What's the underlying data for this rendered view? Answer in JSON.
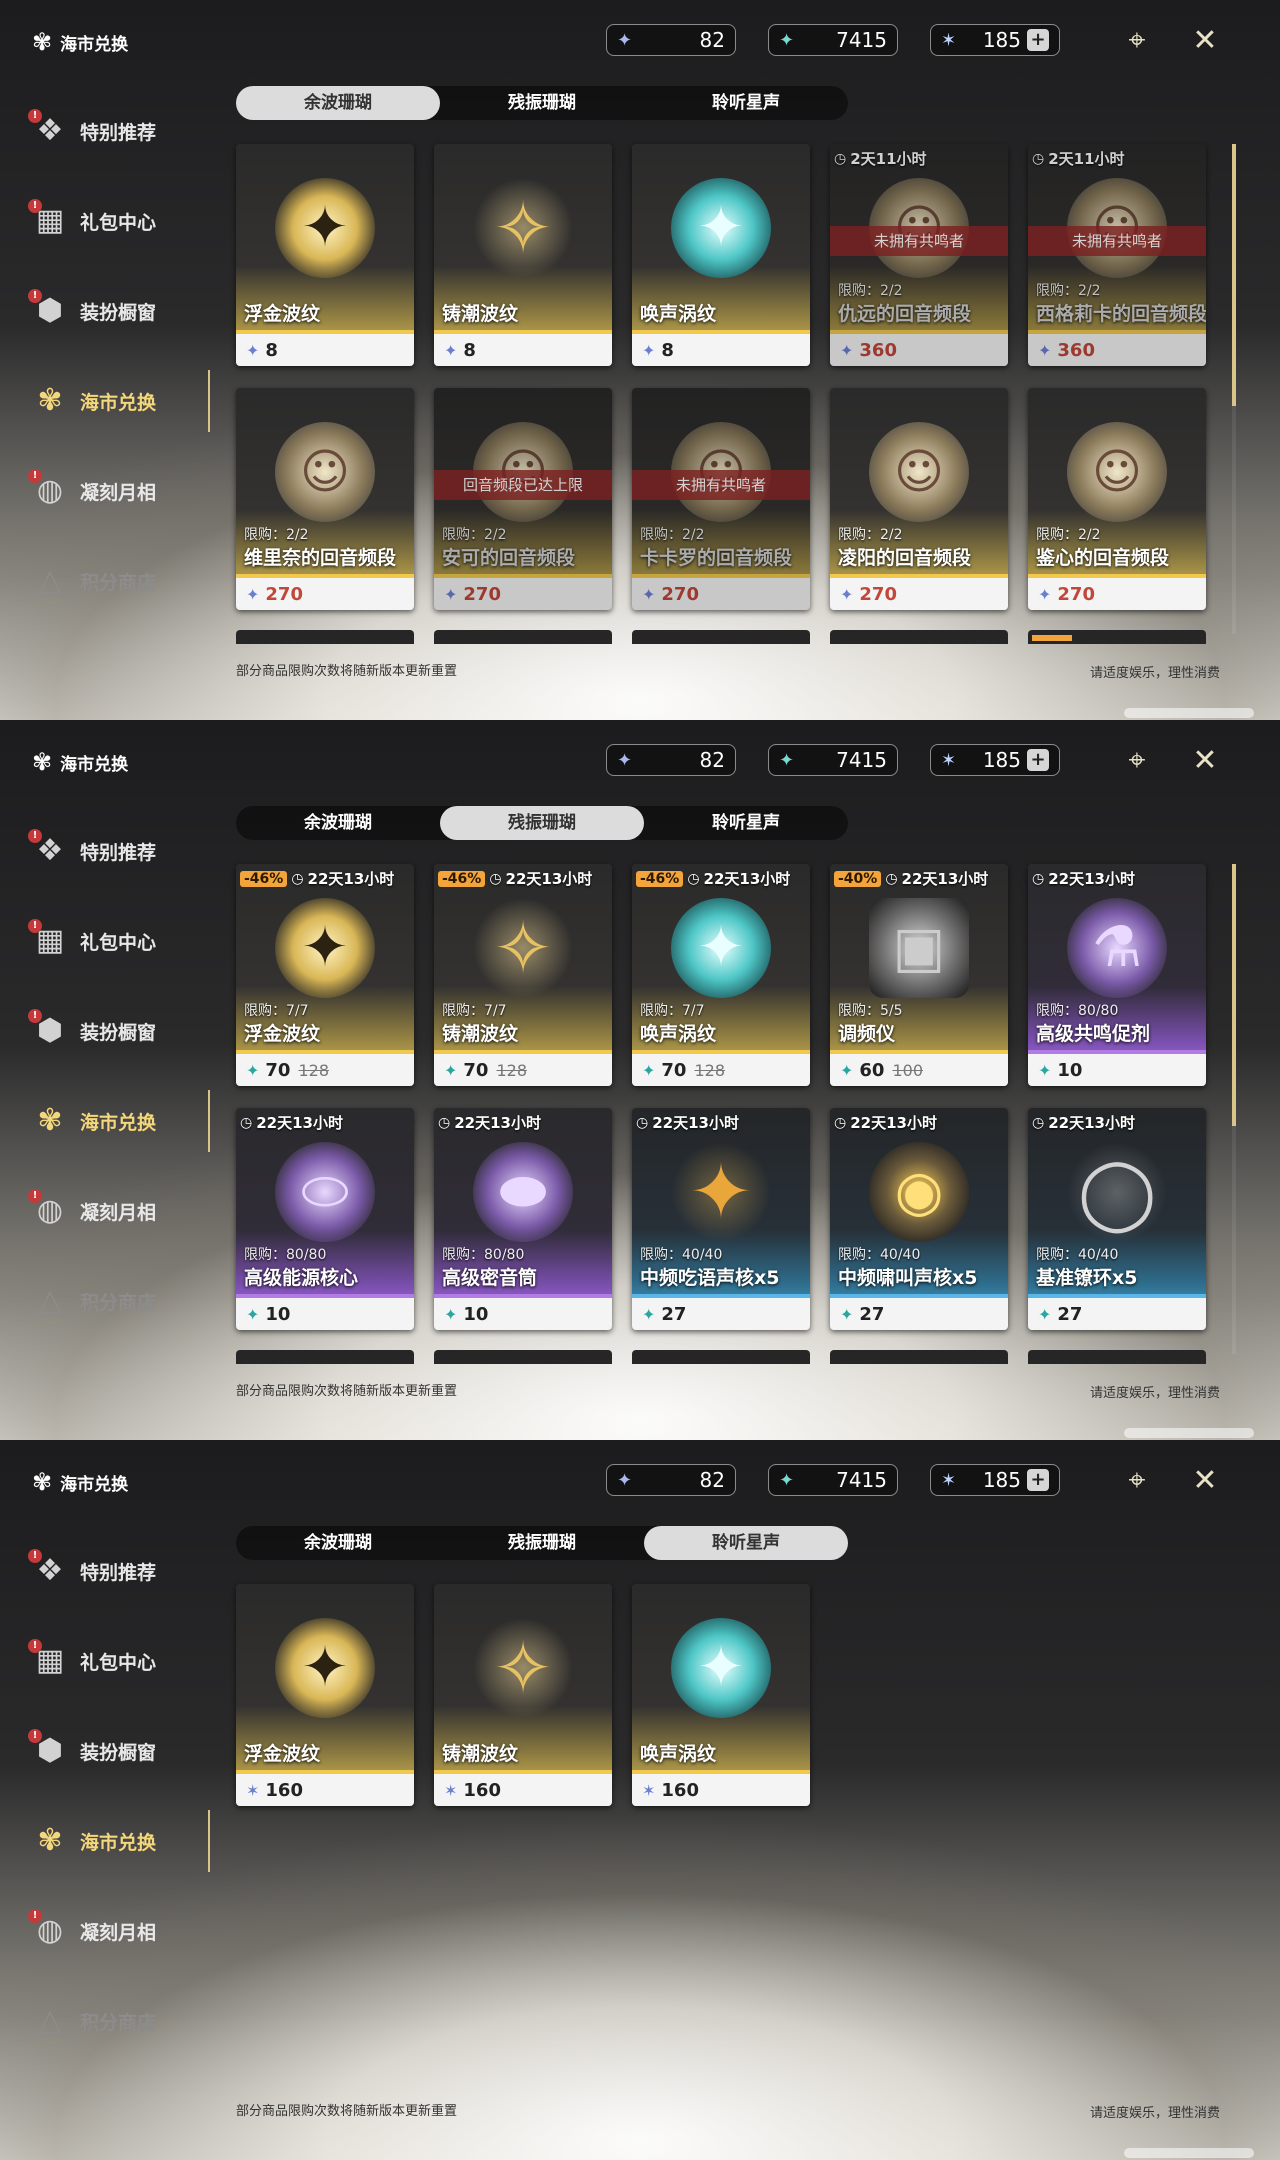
{
  "header": {
    "title": "海市兑换",
    "currencies": [
      {
        "icon": "wave-coral-icon",
        "value": "82"
      },
      {
        "icon": "resonance-coral-icon",
        "value": "7415"
      },
      {
        "icon": "starsong-icon",
        "value": "185",
        "plus": "+"
      }
    ]
  },
  "sidebar": {
    "items": [
      {
        "label": "特别推荐",
        "icon": "featured-icon",
        "badge": "!"
      },
      {
        "label": "礼包中心",
        "icon": "gift-icon",
        "badge": "!"
      },
      {
        "label": "装扮橱窗",
        "icon": "wardrobe-icon",
        "badge": "!"
      },
      {
        "label": "海市兑换",
        "icon": "coral-exchange-icon"
      },
      {
        "label": "凝刻月相",
        "icon": "moon-phase-icon",
        "badge": "!"
      },
      {
        "label": "积分商店",
        "icon": "points-shop-icon"
      }
    ]
  },
  "tabs": [
    "余波珊瑚",
    "残振珊瑚",
    "聆听星声"
  ],
  "footer": {
    "left": "部分商品限购次数将随新版本更新重置",
    "right": "请适度娱乐，理性消费"
  },
  "panels": [
    {
      "active_tab": 0,
      "cards": [
        {
          "name": "浮金波纹",
          "price": "8",
          "art": "gold-wave"
        },
        {
          "name": "铸潮波纹",
          "price": "8",
          "art": "tide-blade"
        },
        {
          "name": "唤声涡纹",
          "price": "8",
          "art": "cyan-vortex"
        },
        {
          "name": "仇远的回音频段",
          "price": "360",
          "timer": "2天11小时",
          "banner": "未拥有共鸣者",
          "limit": "限购：2/2",
          "faded": true
        },
        {
          "name": "西格莉卡的回音频段",
          "price": "360",
          "timer": "2天11小时",
          "banner": "未拥有共鸣者",
          "limit": "限购：2/2",
          "faded": true
        },
        {
          "name": "维里奈的回音频段",
          "price": "270",
          "limit": "限购：2/2"
        },
        {
          "name": "安可的回音频段",
          "price": "270",
          "banner": "回音频段已达上限",
          "limit": "限购：2/2",
          "faded": true
        },
        {
          "name": "卡卡罗的回音频段",
          "price": "270",
          "banner": "未拥有共鸣者",
          "limit": "限购：2/2",
          "faded": true
        },
        {
          "name": "凌阳的回音频段",
          "price": "270",
          "limit": "限购：2/2"
        },
        {
          "name": "鉴心的回音频段",
          "price": "270",
          "limit": "限购：2/2"
        }
      ]
    },
    {
      "active_tab": 1,
      "cards": [
        {
          "name": "浮金波纹",
          "price": "70",
          "old": "128",
          "discount": "-46%",
          "timer": "22天13小时",
          "limit": "限购：7/7"
        },
        {
          "name": "铸潮波纹",
          "price": "70",
          "old": "128",
          "discount": "-46%",
          "timer": "22天13小时",
          "limit": "限购：7/7"
        },
        {
          "name": "唤声涡纹",
          "price": "70",
          "old": "128",
          "discount": "-46%",
          "timer": "22天13小时",
          "limit": "限购：7/7"
        },
        {
          "name": "调频仪",
          "price": "60",
          "old": "100",
          "discount": "-40%",
          "timer": "22天13小时",
          "limit": "限购：5/5"
        },
        {
          "name": "高级共鸣促剂",
          "price": "10",
          "timer": "22天13小时",
          "limit": "限购：80/80"
        },
        {
          "name": "高级能源核心",
          "price": "10",
          "timer": "22天13小时",
          "limit": "限购：80/80"
        },
        {
          "name": "高级密音筒",
          "price": "10",
          "timer": "22天13小时",
          "limit": "限购：80/80"
        },
        {
          "name": "中频吃语声核x5",
          "price": "27",
          "timer": "22天13小时",
          "limit": "限购：40/40"
        },
        {
          "name": "中频啸叫声核x5",
          "price": "27",
          "timer": "22天13小时",
          "limit": "限购：40/40"
        },
        {
          "name": "基准镣环x5",
          "price": "27",
          "timer": "22天13小时",
          "limit": "限购：40/40"
        }
      ]
    },
    {
      "active_tab": 2,
      "cards": [
        {
          "name": "浮金波纹",
          "price": "160"
        },
        {
          "name": "铸潮波纹",
          "price": "160"
        },
        {
          "name": "唤声涡纹",
          "price": "160"
        }
      ]
    }
  ],
  "colors": {
    "accent": "#f3d77a",
    "discount": "#f3a43a",
    "banner": "#962828"
  }
}
